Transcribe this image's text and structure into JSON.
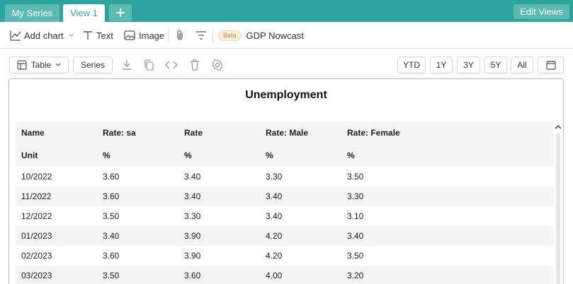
{
  "tabs": {
    "series_label": "My Series",
    "view_label": "View 1",
    "edit_views_label": "Edit Views"
  },
  "toolbar": {
    "add_chart_label": "Add chart",
    "text_label": "Text",
    "image_label": "Image",
    "beta_label": "Beta",
    "nowcast_label": "GDP Nowcast"
  },
  "controls": {
    "table_label": "Table",
    "series_label": "Series",
    "ranges": [
      "YTD",
      "1Y",
      "3Y",
      "5Y",
      "All"
    ]
  },
  "panel": {
    "title": "Unemployment",
    "columns": [
      "Name",
      "Rate: sa",
      "Rate",
      "Rate: Male",
      "Rate: Female"
    ],
    "units": [
      "Unit",
      "%",
      "%",
      "%",
      "%"
    ],
    "rows": [
      [
        "10/2022",
        "3.60",
        "3.40",
        "3.30",
        "3.50"
      ],
      [
        "11/2022",
        "3.60",
        "3.40",
        "3.40",
        "3.30"
      ],
      [
        "12/2022",
        "3.50",
        "3.30",
        "3.40",
        "3.10"
      ],
      [
        "01/2023",
        "3.40",
        "3.90",
        "4.20",
        "3.40"
      ],
      [
        "02/2023",
        "3.60",
        "3.90",
        "4.20",
        "3.50"
      ],
      [
        "03/2023",
        "3.50",
        "3.60",
        "4.00",
        "3.20"
      ]
    ]
  },
  "colors": {
    "accent": "#2ea59c",
    "tab_inactive": "#5bbab3",
    "panel_border": "#c9a9c9"
  }
}
